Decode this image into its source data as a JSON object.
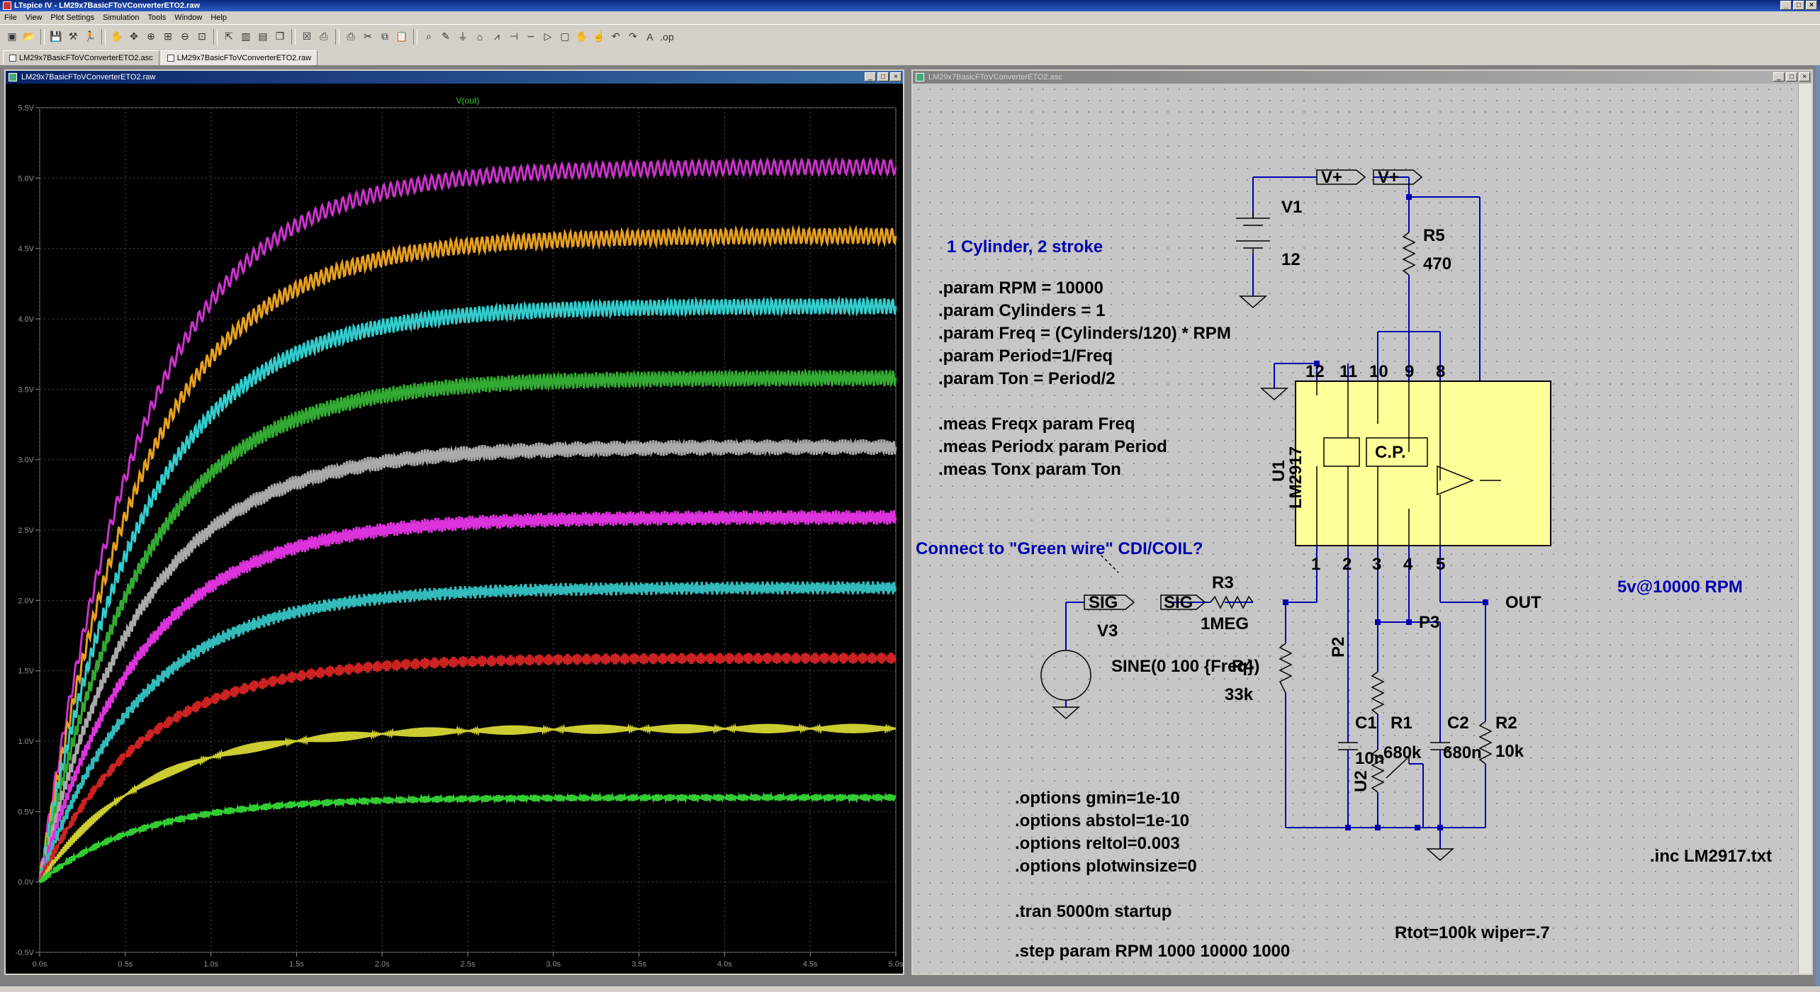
{
  "app": {
    "title": "LTspice IV - LM29x7BasicFToVConverterETO2.raw",
    "menu": [
      "File",
      "View",
      "Plot Settings",
      "Simulation",
      "Tools",
      "Window",
      "Help"
    ],
    "tabs": [
      "LM29x7BasicFToVConverterETO2.asc",
      "LM29x7BasicFToVConverterETO2.raw"
    ]
  },
  "toolbar_icons": [
    "new-schematic-icon",
    "open-icon",
    "save-icon",
    "control-panel-icon",
    "run-icon",
    "halt-icon",
    "pan-icon",
    "zoom-in-icon",
    "zoom-area-icon",
    "zoom-out-icon",
    "zoom-fit-icon",
    "autoscale-icon",
    "tile-vertical-icon",
    "tile-horizontal-icon",
    "cascade-icon",
    "close-window-icon",
    "print-preview-icon",
    "print-icon",
    "cut-icon",
    "copy-icon",
    "paste-icon",
    "find-icon",
    "wire-icon",
    "ground-icon",
    "label-icon",
    "resistor-icon",
    "capacitor-icon",
    "inductor-icon",
    "diode-icon",
    "component-icon",
    "move-icon",
    "drag-icon",
    "undo-icon",
    "redo-icon",
    "text-icon",
    "spice-directive-icon"
  ],
  "plot_window": {
    "title": "LM29x7BasicFToVConverterETO2.raw",
    "trace_label": "V(out)",
    "y_ticks": [
      "5.5V",
      "5.0V",
      "4.5V",
      "4.0V",
      "3.5V",
      "3.0V",
      "2.5V",
      "2.0V",
      "1.5V",
      "1.0V",
      "0.5V",
      "0.0V",
      "-0.5V"
    ],
    "x_ticks": [
      "0.0s",
      "0.5s",
      "1.0s",
      "1.5s",
      "2.0s",
      "2.5s",
      "3.0s",
      "3.5s",
      "4.0s",
      "4.5s",
      "5.0s"
    ]
  },
  "chart_data": {
    "type": "line",
    "title": "V(out)",
    "xlabel": "",
    "ylabel": "",
    "xlim": [
      0,
      5
    ],
    "ylim": [
      -0.5,
      5.5
    ],
    "grid": true,
    "series": [
      {
        "color": "#cc33cc",
        "final": 5.08,
        "tau": 0.6,
        "ripple": 0.01
      },
      {
        "color": "#e6a020",
        "final": 4.59,
        "tau": 0.6,
        "ripple": 0.012
      },
      {
        "color": "#33cccc",
        "final": 4.09,
        "tau": 0.6,
        "ripple": 0.014
      },
      {
        "color": "#33aa33",
        "final": 3.58,
        "tau": 0.6,
        "ripple": 0.016
      },
      {
        "color": "#aaaaaa",
        "final": 3.09,
        "tau": 0.6,
        "ripple": 0.018
      },
      {
        "color": "#dd33dd",
        "final": 2.59,
        "tau": 0.6,
        "ripple": 0.02
      },
      {
        "color": "#33bbbb",
        "final": 2.09,
        "tau": 0.6,
        "ripple": 0.022
      },
      {
        "color": "#cc2222",
        "final": 1.59,
        "tau": 0.6,
        "ripple": 0.025
      },
      {
        "color": "#cccc33",
        "final": 1.09,
        "tau": 0.6,
        "ripple": 0.03
      },
      {
        "color": "#33cc33",
        "final": 0.6,
        "tau": 0.6,
        "ripple": 0.04
      }
    ]
  },
  "schematic_window": {
    "title": "LM29x7BasicFToVConverterETO2.asc",
    "labels": {
      "v1": "V1",
      "v1_val": "12",
      "vplus": "V+",
      "vplus2": "V+",
      "r5": "R5",
      "r5_val": "470",
      "heading": "1 Cylinder, 2 stroke",
      "params": [
        ".param RPM = 10000",
        ".param Cylinders = 1",
        ".param Freq = (Cylinders/120) * RPM",
        ".param Period=1/Freq",
        ".param Ton = Period/2"
      ],
      "meas": [
        ".meas Freqx param Freq",
        ".meas Periodx param Period",
        ".meas Tonx param Ton"
      ],
      "u1": "U1",
      "lm2917": "LM2917",
      "cp": "C.P.",
      "pins_top": [
        "12",
        "11",
        "10",
        "9",
        "8"
      ],
      "pins_bot": [
        "1",
        "2",
        "3",
        "4",
        "5"
      ],
      "connect": "Connect to \"Green wire\" CDI/COIL?",
      "sig1": "SIG",
      "sig2": "SIG",
      "r3": "R3",
      "r3_val": "1MEG",
      "v3": "V3",
      "v3_val": "SINE(0 100 {Freq})",
      "r4": "R4",
      "r4_val": "33k",
      "p2": "P2",
      "p3": "P3",
      "c1": "C1",
      "c1_val": "10n",
      "r1": "R1",
      "r1_val": "680k",
      "c2": "C2",
      "c2_val": "680n",
      "r2": "R2",
      "r2_val": "10k",
      "out_note": "5v@10000 RPM",
      "out": "OUT",
      "u2": "U2",
      "rtot": "Rtot=100k wiper=.7",
      "options": [
        ".options gmin=1e-10",
        ".options abstol=1e-10",
        ".options reltol=0.003",
        ".options plotwinsize=0"
      ],
      "tran": ".tran 5000m startup",
      "step": ".step param RPM 1000 10000 1000",
      "inc": ".inc LM2917.txt"
    }
  }
}
